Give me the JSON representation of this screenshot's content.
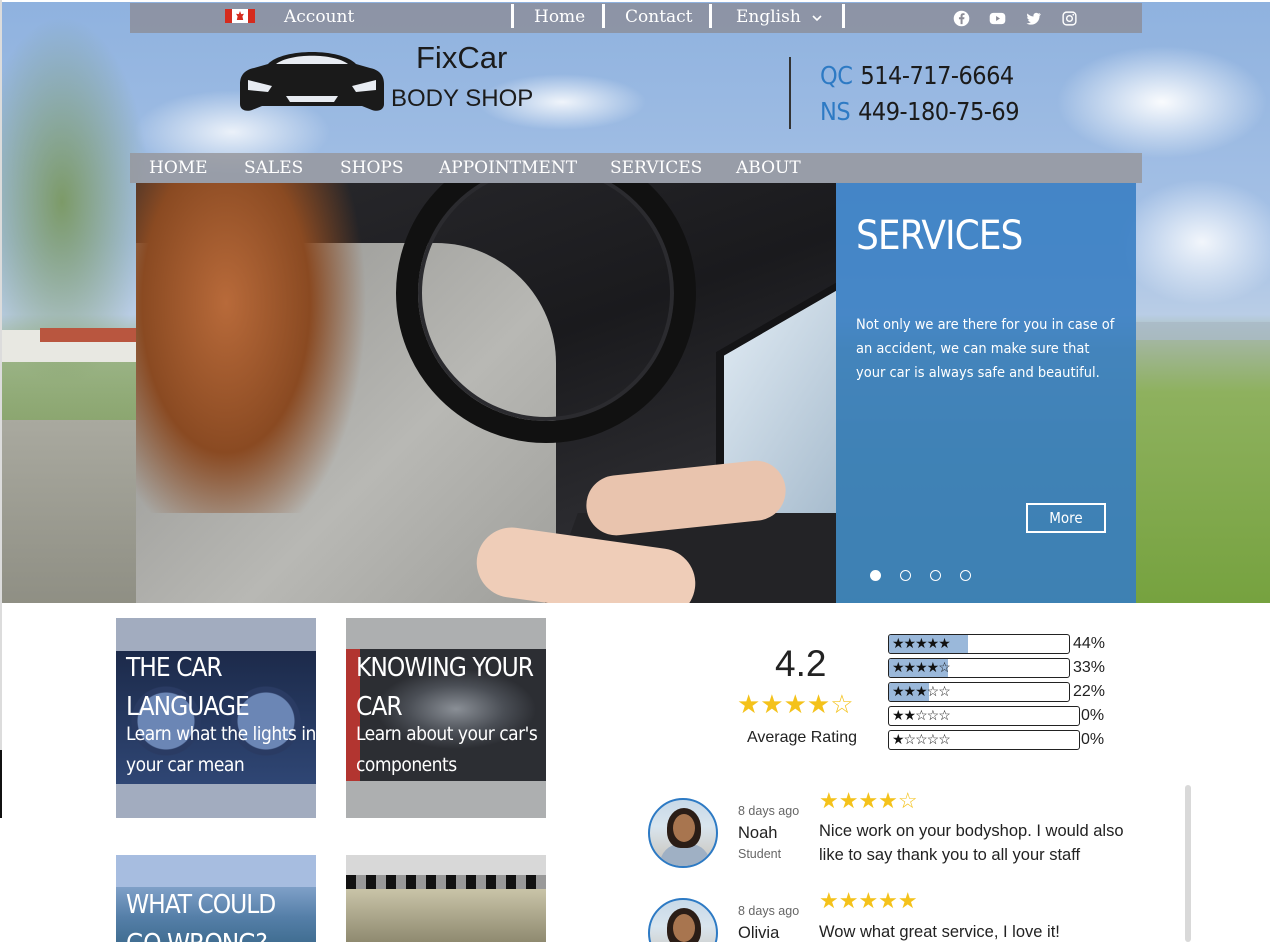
{
  "topbar": {
    "account": "Account",
    "home": "Home",
    "contact": "Contact",
    "language": "English",
    "social": [
      "facebook-icon",
      "youtube-icon",
      "twitter-icon",
      "instagram-icon"
    ]
  },
  "brand": {
    "name": "FixCar",
    "tagline": "BODY SHOP"
  },
  "phones": [
    {
      "code": "QC",
      "number": "514-717-6664"
    },
    {
      "code": "NS",
      "number": "449-180-75-69"
    }
  ],
  "nav": [
    "HOME",
    "SALES",
    "SHOPS",
    "APPOINTMENT",
    "SERVICES",
    "ABOUT"
  ],
  "slider": {
    "title": "SERVICES",
    "text": "Not only we are there for you in case of an accident, we can make sure that your car is always safe and beautiful.",
    "button": "More",
    "slides": 4,
    "active_slide": 1
  },
  "cards": [
    {
      "title": "THE CAR LANGUAGE",
      "subtitle": "Learn what the lights in your car mean"
    },
    {
      "title": "KNOWING YOUR CAR",
      "subtitle": "Learn about your car's components"
    },
    {
      "title": "WHAT COULD GO WRONG?",
      "subtitle": ""
    },
    {
      "title": "",
      "subtitle": ""
    }
  ],
  "rating": {
    "average": "4.2",
    "stars": "★★★★☆",
    "label": "Average Rating",
    "breakdown": [
      {
        "stars": "★★★★★",
        "percent": "44%",
        "value": 0.44
      },
      {
        "stars": "★★★★☆",
        "percent": "33%",
        "value": 0.33
      },
      {
        "stars": "★★★☆☆",
        "percent": "22%",
        "value": 0.22
      },
      {
        "stars": "★★☆☆☆",
        "percent": "0%",
        "value": 0
      },
      {
        "stars": "★☆☆☆☆",
        "percent": "0%",
        "value": 0
      }
    ]
  },
  "reviews": [
    {
      "date": "8 days ago",
      "name": "Noah",
      "role": "Student",
      "stars": "★★★★☆",
      "text": "Nice work on your bodyshop. I would also like to say thank you to all your staff"
    },
    {
      "date": "8 days ago",
      "name": "Olivia",
      "role": "",
      "stars": "★★★★★",
      "text": "Wow what great service, I love it!"
    }
  ],
  "colors": {
    "accent": "#2d7ac4",
    "panel": "#377dc3",
    "star": "#f4c21b"
  }
}
